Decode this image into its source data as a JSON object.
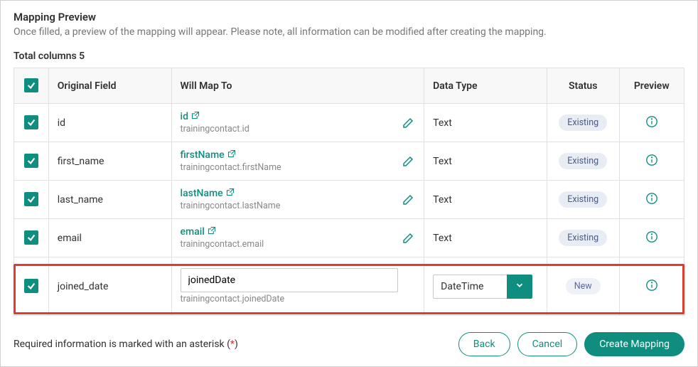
{
  "header": {
    "title": "Mapping Preview",
    "subtitle": "Once filled, a preview of the mapping will appear. Please note, all information can be modified after creating the mapping.",
    "total_label": "Total columns 5"
  },
  "table": {
    "headers": {
      "original": "Original Field",
      "map_to": "Will Map To",
      "data_type": "Data Type",
      "status": "Status",
      "preview": "Preview"
    },
    "rows": [
      {
        "original": "id",
        "map_link": "id",
        "map_sub": "trainingcontact.id",
        "data_type": "Text",
        "status": "Existing",
        "editable": false
      },
      {
        "original": "first_name",
        "map_link": "firstName",
        "map_sub": "trainingcontact.firstName",
        "data_type": "Text",
        "status": "Existing",
        "editable": false
      },
      {
        "original": "last_name",
        "map_link": "lastName",
        "map_sub": "trainingcontact.lastName",
        "data_type": "Text",
        "status": "Existing",
        "editable": false
      },
      {
        "original": "email",
        "map_link": "email",
        "map_sub": "trainingcontact.email",
        "data_type": "Text",
        "status": "Existing",
        "editable": false
      },
      {
        "original": "joined_date",
        "map_input": "joinedDate",
        "map_sub": "trainingcontact.joinedDate",
        "data_type": "DateTime",
        "status": "New",
        "editable": true
      }
    ]
  },
  "footer": {
    "required_note_prefix": "Required information is marked with an asterisk (",
    "required_note_ast": "*",
    "required_note_suffix": ")",
    "back": "Back",
    "cancel": "Cancel",
    "create": "Create Mapping"
  }
}
